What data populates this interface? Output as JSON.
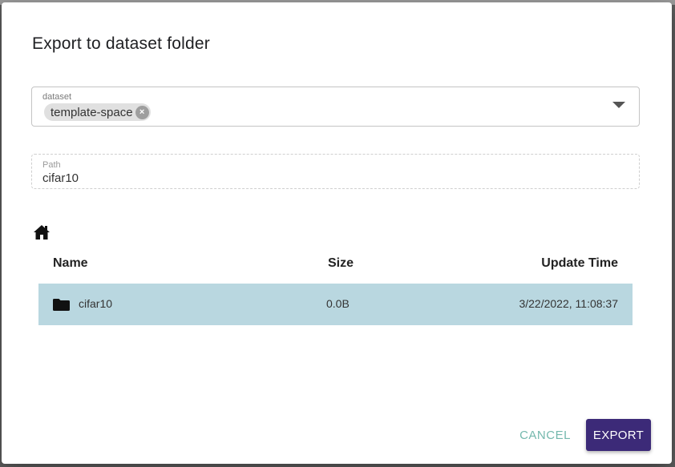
{
  "dialog": {
    "title": "Export to dataset folder"
  },
  "dataset_field": {
    "label": "dataset",
    "selected_chip": "template-space",
    "chip_close_glyph": "×"
  },
  "path_field": {
    "label": "Path",
    "value": "cifar10"
  },
  "file_table": {
    "headers": {
      "name": "Name",
      "size": "Size",
      "update_time": "Update Time"
    },
    "rows": [
      {
        "name": "cifar10",
        "size": "0.0B",
        "update_time": "3/22/2022, 11:08:37",
        "icon": "folder-icon"
      }
    ],
    "selected_row_color": "#b9d7e0"
  },
  "icons": {
    "home": "home-icon",
    "dropdown": "dropdown-arrow-icon"
  },
  "actions": {
    "cancel_label": "CANCEL",
    "export_label": "EXPORT"
  },
  "colors": {
    "primary": "#3c2a78",
    "cancel_text": "#74b8ad"
  }
}
